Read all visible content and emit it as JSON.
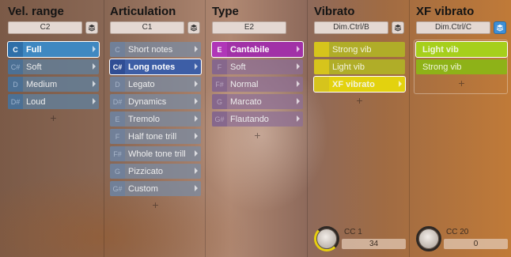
{
  "columns": {
    "vel": {
      "title": "Vel. range",
      "key": "C2",
      "items": [
        {
          "note": "C",
          "label": "Full",
          "selected": true
        },
        {
          "note": "C#",
          "label": "Soft"
        },
        {
          "note": "D",
          "label": "Medium"
        },
        {
          "note": "D#",
          "label": "Loud"
        }
      ],
      "add": "+"
    },
    "art": {
      "title": "Articulation",
      "key": "C1",
      "items": [
        {
          "note": "C",
          "label": "Short notes"
        },
        {
          "note": "C#",
          "label": "Long notes",
          "selected": true
        },
        {
          "note": "D",
          "label": "Legato"
        },
        {
          "note": "D#",
          "label": "Dynamics"
        },
        {
          "note": "E",
          "label": "Tremolo"
        },
        {
          "note": "F",
          "label": "Half tone trill"
        },
        {
          "note": "F#",
          "label": "Whole tone trill"
        },
        {
          "note": "G",
          "label": "Pizzicato"
        },
        {
          "note": "G#",
          "label": "Custom"
        }
      ],
      "add": "+"
    },
    "type": {
      "title": "Type",
      "key": "E2",
      "items": [
        {
          "note": "E",
          "label": "Cantabile",
          "selected": true
        },
        {
          "note": "F",
          "label": "Soft"
        },
        {
          "note": "F#",
          "label": "Normal"
        },
        {
          "note": "G",
          "label": "Marcato"
        },
        {
          "note": "G#",
          "label": "Flautando"
        }
      ],
      "add": "+"
    },
    "vib": {
      "title": "Vibrato",
      "key": "Dim.Ctrl/B",
      "items": [
        {
          "label": "Strong vib"
        },
        {
          "label": "Light vib"
        },
        {
          "label": "XF vibrato",
          "selected": true
        }
      ],
      "add": "+",
      "cc_label": "CC 1",
      "cc_value": "34"
    },
    "xf": {
      "title": "XF vibrato",
      "key": "Dim.Ctrl/C",
      "items": [
        {
          "label": "Light vib",
          "selected": true
        },
        {
          "label": "Strong vib"
        }
      ],
      "add": "+",
      "cc_label": "CC 20",
      "cc_value": "0"
    }
  },
  "colors": {
    "vel_selected": "#3f88c1",
    "art_selected": "#3d5ea6",
    "type_selected": "#a131a7",
    "vib_selected": "#e3d20e",
    "xf_selected": "#a6cf1c",
    "layer_active": "#3e8fd6"
  },
  "icons": {
    "layer": "layers-icon",
    "arrow": "chevron-right-icon",
    "knob": "rotary-knob-icon"
  }
}
